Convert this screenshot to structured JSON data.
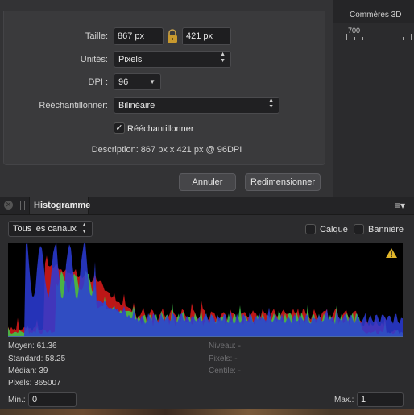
{
  "dialog": {
    "size_label": "Taille:",
    "width_value": "867 px",
    "height_value": "421 px",
    "units_label": "Unités:",
    "units_value": "Pixels",
    "dpi_label": "DPI :",
    "dpi_value": "96",
    "resample_label": "Rééchantillonner:",
    "resample_value": "Bilinéaire",
    "resample_check_label": "Rééchantillonner",
    "resample_checked": true,
    "description": "Description: 867 px x 421 px @ 96DPI",
    "cancel_label": "Annuler",
    "resize_label": "Redimensionner"
  },
  "right_panel": {
    "tab_label": "Commères 3D",
    "ruler_label": "700"
  },
  "histogram": {
    "title": "Histogramme",
    "channel_value": "Tous les canaux",
    "layer_label": "Calque",
    "banner_label": "Bannière",
    "stats_left": {
      "mean": "Moyen: 61.36",
      "std": "Standard: 58.25",
      "median": "Médian: 39",
      "pixels": "Pixels: 365007"
    },
    "stats_right": {
      "level": "Niveau: -",
      "pixels": "Pixels: -",
      "percentile": "Centile: -"
    },
    "min_label": "Min.:",
    "min_value": "0",
    "max_label": "Max.:",
    "max_value": "1",
    "colors": {
      "red": "#d01a1a",
      "green": "#3fc24a",
      "blue": "#2c3cd8"
    }
  }
}
